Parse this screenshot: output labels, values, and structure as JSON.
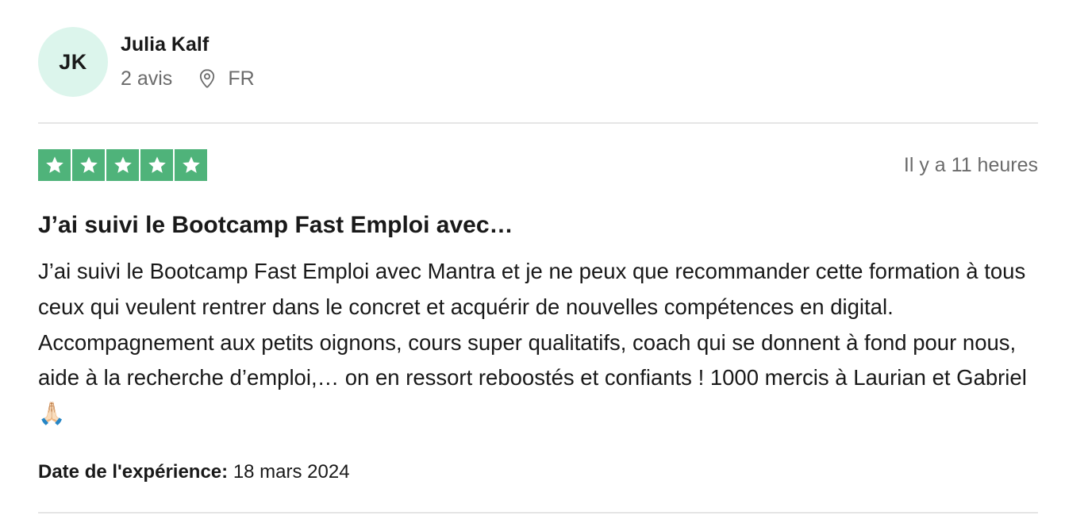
{
  "consumer": {
    "initials": "JK",
    "name": "Julia Kalf",
    "review_count": "2 avis",
    "country": "FR"
  },
  "review": {
    "rating": 5,
    "rating_max": 5,
    "star_color": "#4fb37a",
    "posted": "Il y a 11 heures",
    "title": "J’ai suivi le Bootcamp Fast Emploi avec…",
    "body": "J’ai suivi le Bootcamp Fast Emploi avec Mantra et je ne peux que recommander cette formation à tous ceux qui veulent rentrer dans le concret et acquérir de nouvelles compétences en digital. Accompagnement aux petits oignons, cours super qualitatifs, coach qui se donnent à fond pour nous, aide à la recherche d’emploi,… on en ressort reboostés et confiants ! 1000 mercis à Laurian et Gabriel 🙏🏻",
    "experience_label": "Date de l'expérience:",
    "experience_date": "18 mars 2024"
  },
  "icons": {
    "location": "location-pin-icon",
    "star": "star-icon"
  }
}
